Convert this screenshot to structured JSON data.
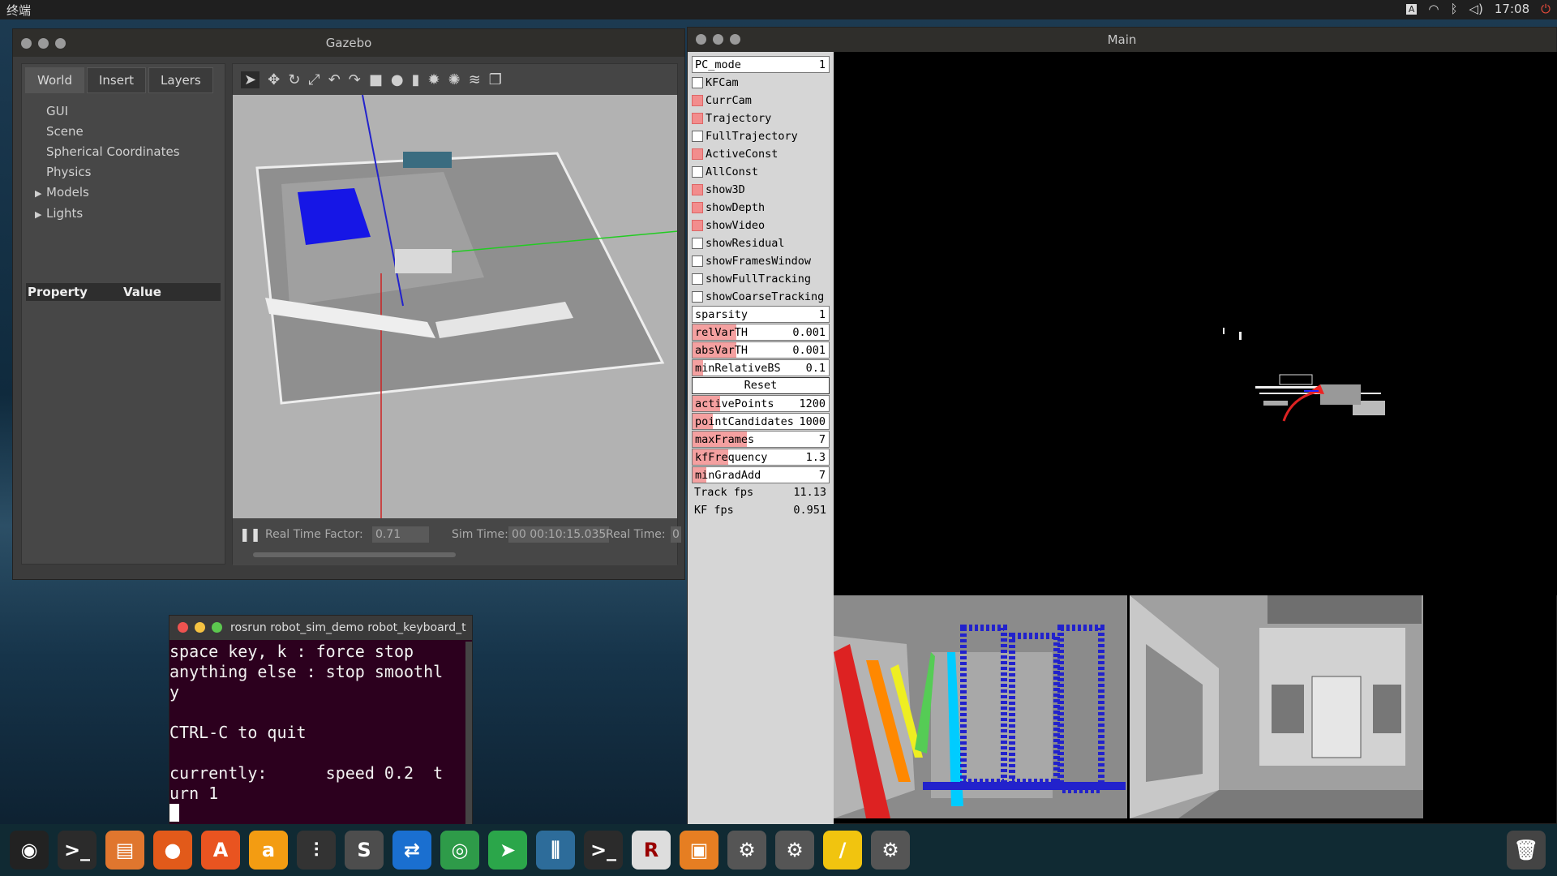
{
  "topbar": {
    "app_title": "终端",
    "time": "17:08"
  },
  "gazebo": {
    "title": "Gazebo",
    "tabs": [
      "World",
      "Insert",
      "Layers"
    ],
    "tree": [
      {
        "label": "GUI",
        "expandable": false
      },
      {
        "label": "Scene",
        "expandable": false
      },
      {
        "label": "Spherical Coordinates",
        "expandable": false
      },
      {
        "label": "Physics",
        "expandable": false
      },
      {
        "label": "Models",
        "expandable": true
      },
      {
        "label": "Lights",
        "expandable": true
      }
    ],
    "property_header": {
      "property": "Property",
      "value": "Value"
    },
    "status": {
      "rtf_label": "Real Time Factor:",
      "rtf_value": "0.71",
      "sim_label": "Sim Time:",
      "sim_value": "00 00:10:15.035",
      "real_label": "Real Time:",
      "real_value": "0"
    }
  },
  "main": {
    "title": "Main",
    "pc_mode": {
      "label": "PC_mode",
      "value": "1"
    },
    "checkboxes": [
      {
        "label": "KFCam",
        "checked": false
      },
      {
        "label": "CurrCam",
        "checked": true
      },
      {
        "label": "Trajectory",
        "checked": true
      },
      {
        "label": "FullTrajectory",
        "checked": false
      },
      {
        "label": "ActiveConst",
        "checked": true
      },
      {
        "label": "AllConst",
        "checked": false
      },
      {
        "label": "show3D",
        "checked": true
      },
      {
        "label": "showDepth",
        "checked": true
      },
      {
        "label": "showVideo",
        "checked": true
      },
      {
        "label": "showResidual",
        "checked": false
      },
      {
        "label": "showFramesWindow",
        "checked": false
      },
      {
        "label": "showFullTracking",
        "checked": false
      },
      {
        "label": "showCoarseTracking",
        "checked": false
      }
    ],
    "sliders": [
      {
        "label": "sparsity",
        "value": "1",
        "fill": 0.0
      },
      {
        "label": "relVarTH",
        "value": "0.001",
        "fill": 0.32
      },
      {
        "label": "absVarTH",
        "value": "0.001",
        "fill": 0.32
      },
      {
        "label": "minRelativeBS",
        "value": "0.1",
        "fill": 0.08
      }
    ],
    "reset_label": "Reset",
    "sliders2": [
      {
        "label": "activePoints",
        "value": "1200",
        "fill": 0.2
      },
      {
        "label": "pointCandidates",
        "value": "1000",
        "fill": 0.15
      },
      {
        "label": "maxFrames",
        "value": "7",
        "fill": 0.4
      },
      {
        "label": "kfFrequency",
        "value": "1.3",
        "fill": 0.26
      },
      {
        "label": "minGradAdd",
        "value": "7",
        "fill": 0.1
      }
    ],
    "stats": [
      {
        "label": "Track fps",
        "value": "11.13"
      },
      {
        "label": "KF fps",
        "value": "0.951"
      }
    ]
  },
  "terminal": {
    "title": "rosrun robot_sim_demo robot_keyboard_t",
    "lines": [
      "space key, k : force stop",
      "anything else : stop smoothl",
      "y",
      "",
      "CTRL-C to quit",
      "",
      "currently:      speed 0.2  t",
      "urn 1"
    ]
  },
  "dock": {
    "icons": [
      "ubuntu-logo-icon",
      "terminal-icon",
      "files-icon",
      "firefox-icon",
      "software-center-icon",
      "amazon-icon",
      "mixer-icon",
      "sublime-icon",
      "teamviewer-icon",
      "chrome-icon",
      "telegram-icon",
      "equalizer-icon",
      "terminal-icon",
      "rviz-icon",
      "package-icon",
      "settings-icon",
      "settings-icon",
      "notes-icon",
      "settings-icon",
      "trash-icon"
    ]
  }
}
